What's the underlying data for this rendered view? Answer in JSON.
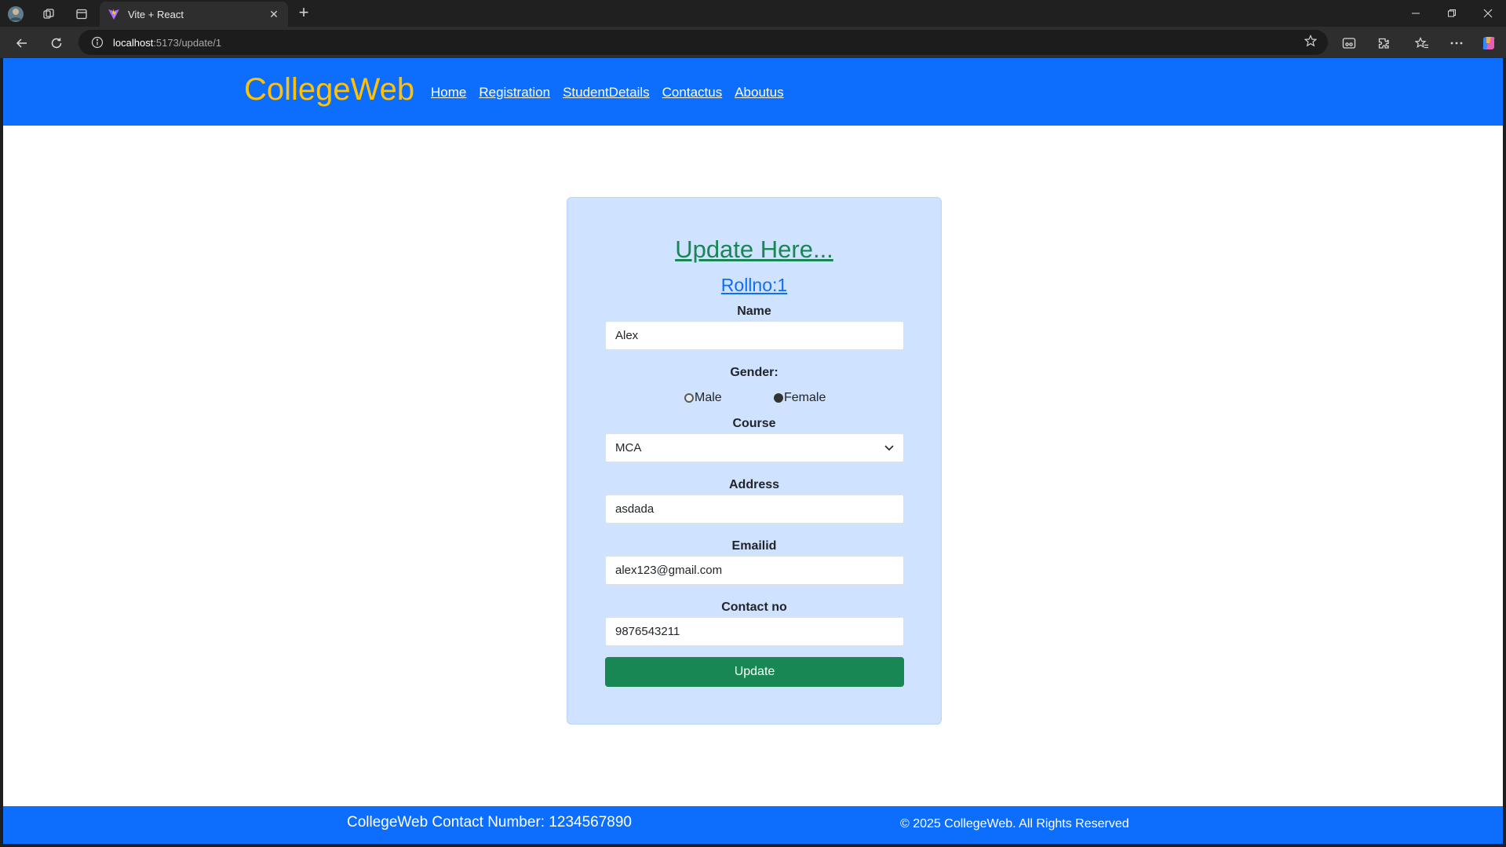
{
  "browser": {
    "tab_title": "Vite + React",
    "url_host": "localhost",
    "url_path": ":5173/update/1",
    "new_tab_symbol": "+",
    "close_symbol": "✕"
  },
  "nav": {
    "brand": "CollegeWeb",
    "links": [
      "Home",
      "Registration",
      "StudentDetails",
      "Contactus",
      "Aboutus"
    ]
  },
  "form": {
    "heading": "Update Here...",
    "rollno": "Rollno:1",
    "name_label": "Name",
    "name_value": "Alex",
    "gender_label": "Gender:",
    "gender_options": [
      "Male",
      "Female"
    ],
    "gender_selected": "Female",
    "course_label": "Course",
    "course_value": "MCA",
    "address_label": "Address",
    "address_value": "asdada",
    "email_label": "Emailid",
    "email_value": "alex123@gmail.com",
    "contact_label": "Contact no",
    "contact_value": "9876543211",
    "submit_label": "Update"
  },
  "footer": {
    "contact": "CollegeWeb Contact Number: 1234567890",
    "copyright": "© 2025 CollegeWeb. All Rights Reserved"
  },
  "colors": {
    "primary": "#0d6efd",
    "brand": "#ffc107",
    "success": "#198754",
    "card_bg": "#cfe2ff"
  }
}
